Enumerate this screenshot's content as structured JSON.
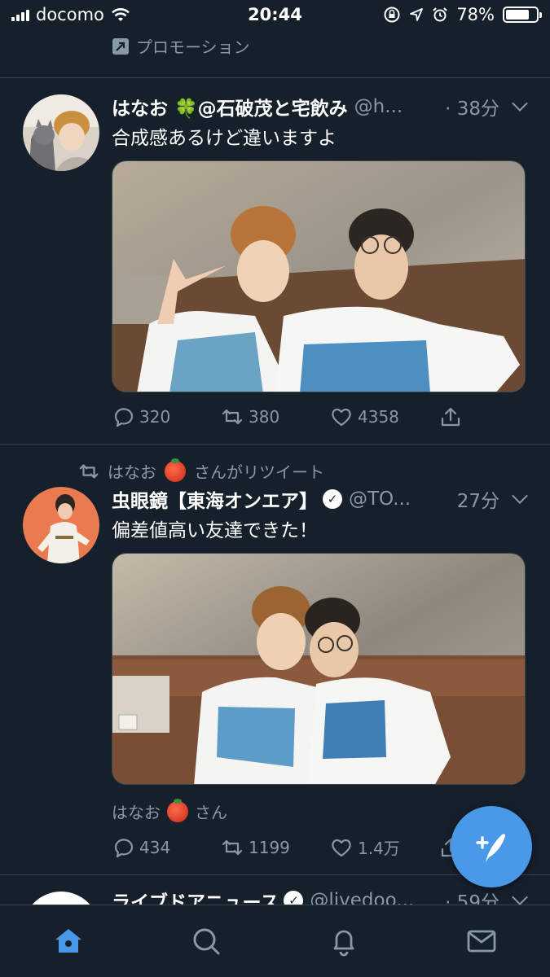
{
  "status_bar": {
    "carrier": "docomo",
    "time": "20:44",
    "battery": "78%",
    "battery_level": 0.78
  },
  "promotion": {
    "label": "プロモーション"
  },
  "tweets": [
    {
      "name": "はなお 🍀@石破茂と宅飲み",
      "handle": "@h...",
      "time": "· 38分",
      "text": "合成感あるけど違いますよ",
      "replies": "320",
      "retweets": "380",
      "likes": "4358"
    },
    {
      "retweeted_by": "はなお",
      "retweeted_suffix": "さんがリツイート",
      "name": "虫眼鏡【東海オンエア】",
      "handle": "@TO...",
      "time": "27分",
      "text": "偏差値高い友達できた！",
      "liked_by": "はなお",
      "liked_suffix": "さん",
      "replies": "434",
      "retweets": "1199",
      "likes": "1.4万"
    },
    {
      "name": "ライブドアニュース",
      "handle": "@livedoo...",
      "time": "· 59分"
    }
  ],
  "colors": {
    "background": "#15202b",
    "secondary_text": "#8899a6",
    "accent": "#4a99e9",
    "divider": "#38444d"
  },
  "icons": [
    "signal-icon",
    "wifi-icon",
    "lock-rotation-icon",
    "location-icon",
    "alarm-icon",
    "battery-icon",
    "promoted-icon",
    "reply-icon",
    "retweet-icon",
    "like-icon",
    "share-icon",
    "compose-icon",
    "home-icon",
    "search-icon",
    "notifications-icon",
    "messages-icon"
  ]
}
